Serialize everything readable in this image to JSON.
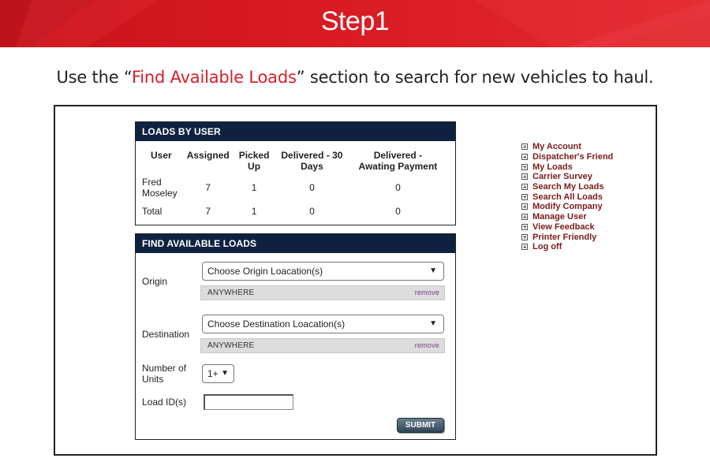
{
  "header": {
    "title": "Step1"
  },
  "instruction": {
    "prefix": "Use the “",
    "highlight": "Find Available Loads",
    "suffix": "” section to search for new vehicles to haul."
  },
  "colors": {
    "banner_red": "#d91a22",
    "panel_navy": "#0e2240",
    "link_maroon": "#7a1a1a"
  },
  "loads_by_user": {
    "heading": "LOADS BY USER",
    "columns": [
      "User",
      "Assigned",
      "Picked Up",
      "Delivered - 30 Days",
      "Delivered - Awating Payment"
    ],
    "rows": [
      [
        "Fred Moseley",
        "7",
        "1",
        "0",
        "0"
      ],
      [
        "Total",
        "7",
        "1",
        "0",
        "0"
      ]
    ]
  },
  "find_loads": {
    "heading": "FIND AVAILABLE LOADS",
    "origin": {
      "label": "Origin",
      "placeholder": "Choose Origin Loacation(s)",
      "chip": "ANYWHERE",
      "remove": "remove"
    },
    "destination": {
      "label": "Destination",
      "placeholder": "Choose Destination Loacation(s)",
      "chip": "ANYWHERE",
      "remove": "remove"
    },
    "units": {
      "label": "Number of Units",
      "value": "1+"
    },
    "load_id": {
      "label": "Load ID(s)",
      "value": ""
    },
    "submit_label": "SUBMIT"
  },
  "side_menu": {
    "items": [
      {
        "label": "My Account",
        "icon": "plus-box-icon"
      },
      {
        "label": "Dispatcher's Friend",
        "icon": "plus-box-icon"
      },
      {
        "label": "My Loads",
        "icon": "plus-box-icon"
      },
      {
        "label": "Carrier Survey",
        "icon": "plus-box-icon"
      },
      {
        "label": "Search My Loads",
        "icon": "plus-box-icon"
      },
      {
        "label": "Search All Loads",
        "icon": "plus-box-icon"
      },
      {
        "label": "Modify Company",
        "icon": "plus-box-icon"
      },
      {
        "label": "Manage User",
        "icon": "plus-box-icon"
      },
      {
        "label": "View Feedback",
        "icon": "plus-box-icon"
      },
      {
        "label": "Printer Friendly",
        "icon": "plus-box-icon"
      },
      {
        "label": "Log off",
        "icon": "plus-box-icon"
      }
    ]
  }
}
